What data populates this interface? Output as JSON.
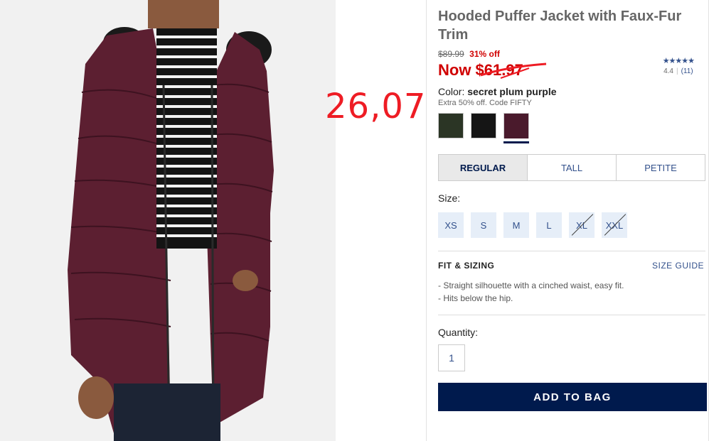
{
  "product": {
    "title": "Hooded Puffer Jacket with Faux-Fur Trim",
    "original_price": "$89.99",
    "percent_off": "31% off",
    "now_price": "Now $61.97",
    "rating_stars": "★★★★★",
    "rating_value": "4.4",
    "rating_count": "(11)",
    "image_icon": "model-wearing-jacket-image"
  },
  "annotation": {
    "text": "26,07",
    "color": "#ee1c24"
  },
  "color": {
    "label": "Color:",
    "selected_name": "secret plum purple",
    "promo": "Extra 50% off. Code FIFTY",
    "swatches": [
      {
        "name": "olive",
        "hex": "#2b3525"
      },
      {
        "name": "black",
        "hex": "#151515"
      },
      {
        "name": "secret plum purple",
        "hex": "#4a1a2c",
        "selected": true
      }
    ]
  },
  "fit_tabs": [
    "REGULAR",
    "TALL",
    "PETITE"
  ],
  "size": {
    "label": "Size:",
    "options": [
      {
        "label": "XS",
        "available": true
      },
      {
        "label": "S",
        "available": true
      },
      {
        "label": "M",
        "available": true
      },
      {
        "label": "L",
        "available": true
      },
      {
        "label": "XL",
        "available": false
      },
      {
        "label": "XXL",
        "available": false
      }
    ]
  },
  "fit_sizing": {
    "title": "FIT & SIZING",
    "guide_link": "SIZE GUIDE",
    "bullets": [
      "- Straight silhouette with a cinched waist, easy fit.",
      "- Hits below the hip."
    ]
  },
  "quantity": {
    "label": "Quantity:",
    "value": "1"
  },
  "add_to_bag": "ADD TO BAG",
  "colors": {
    "brand_navy": "#001a4d",
    "sale_red": "#d00000",
    "link_blue": "#33518c"
  }
}
